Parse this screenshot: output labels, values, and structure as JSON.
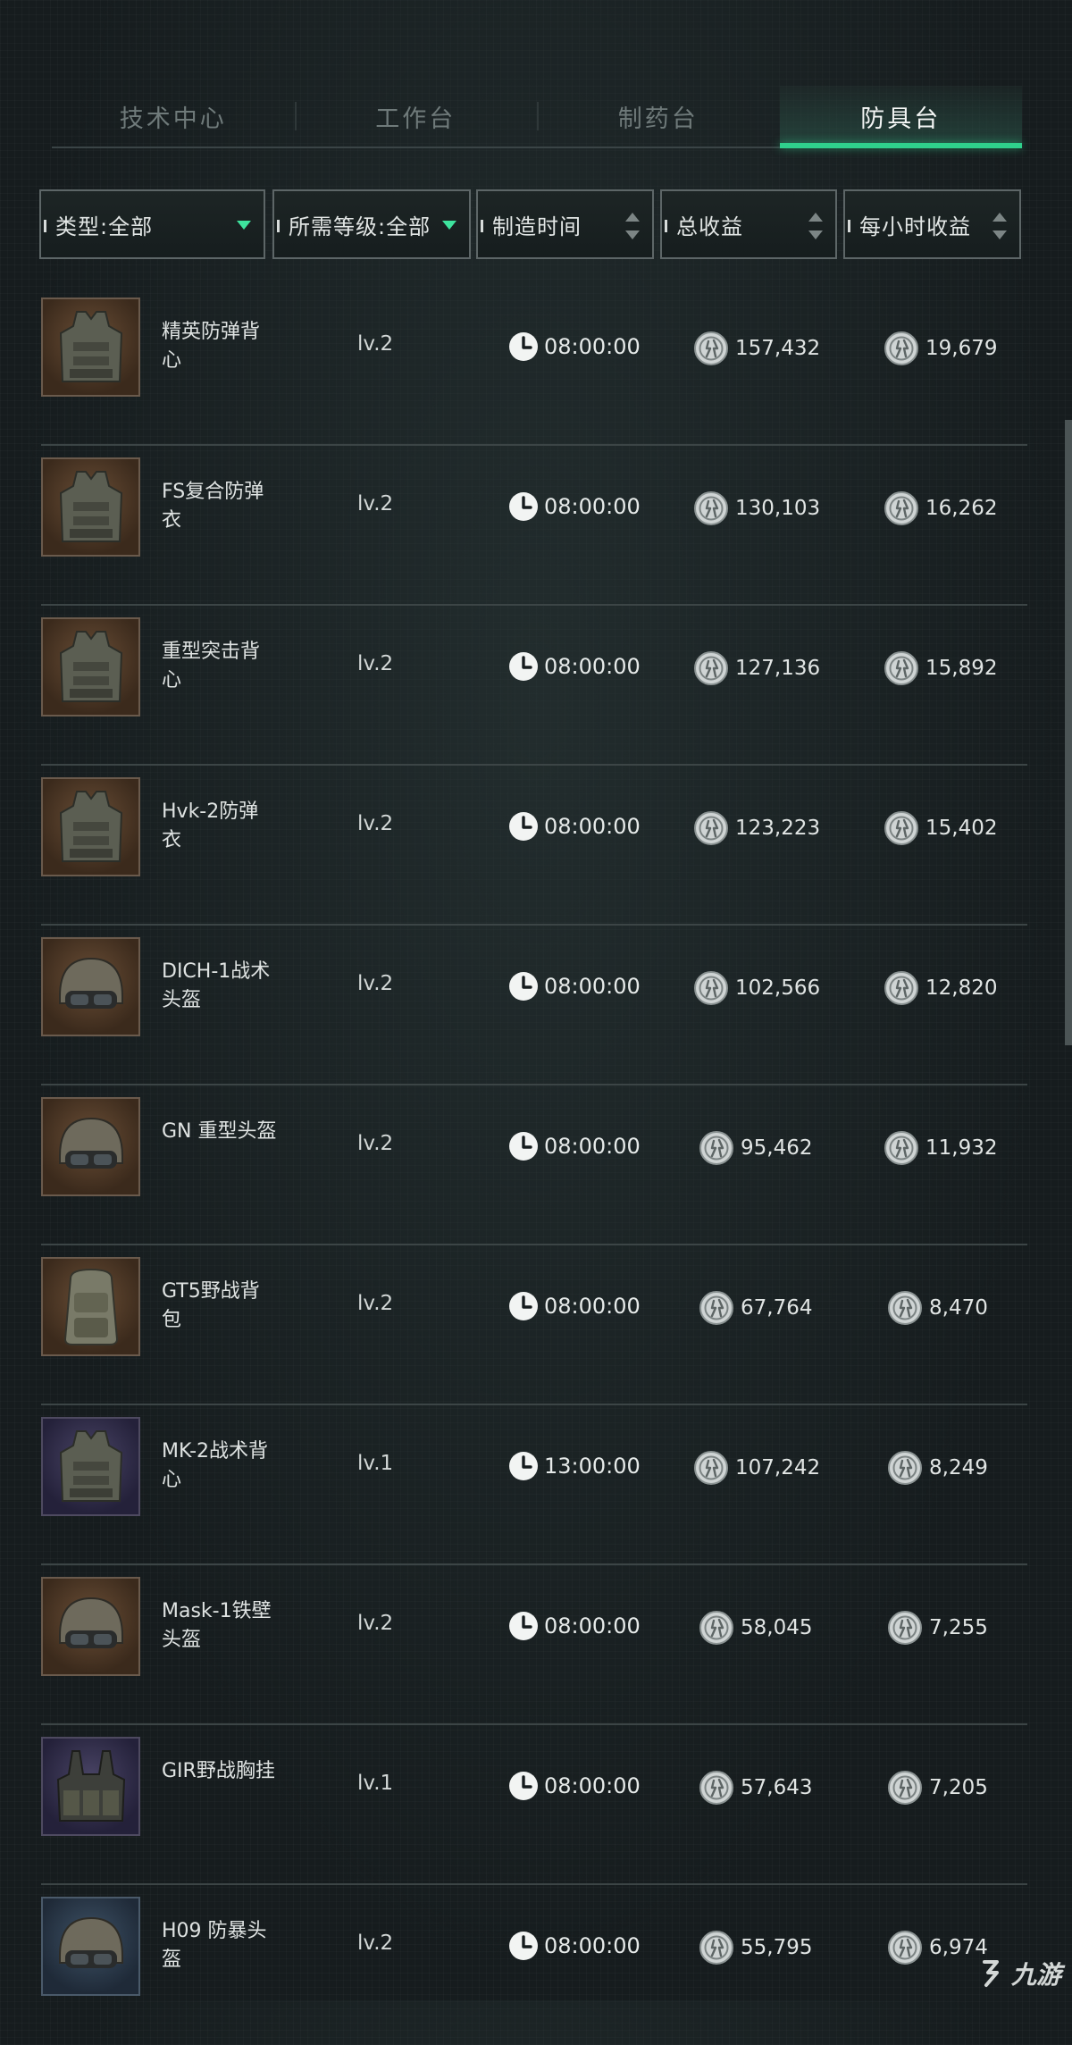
{
  "tabs": [
    {
      "label": "技术中心",
      "active": false
    },
    {
      "label": "工作台",
      "active": false
    },
    {
      "label": "制药台",
      "active": false
    },
    {
      "label": "防具台",
      "active": true
    }
  ],
  "filters": {
    "type": "类型:全部",
    "level": "所需等级:全部",
    "time": "制造时间",
    "total": "总收益",
    "hourly": "每小时收益"
  },
  "colors": {
    "accent": "#2fd08c",
    "background": "#161c1e",
    "divider": "#3c4546"
  },
  "items": [
    {
      "name": "精英防弹背心",
      "level": "lv.2",
      "time": "08:00:00",
      "total": "157,432",
      "hourly": "19,679",
      "icon": "vest-icon",
      "rarity": "orange"
    },
    {
      "name": "FS复合防弹衣",
      "level": "lv.2",
      "time": "08:00:00",
      "total": "130,103",
      "hourly": "16,262",
      "icon": "vest-icon",
      "rarity": "orange"
    },
    {
      "name": "重型突击背心",
      "level": "lv.2",
      "time": "08:00:00",
      "total": "127,136",
      "hourly": "15,892",
      "icon": "vest-icon",
      "rarity": "orange"
    },
    {
      "name": "Hvk-2防弹衣",
      "level": "lv.2",
      "time": "08:00:00",
      "total": "123,223",
      "hourly": "15,402",
      "icon": "vest-icon",
      "rarity": "orange"
    },
    {
      "name": "DICH-1战术头盔",
      "level": "lv.2",
      "time": "08:00:00",
      "total": "102,566",
      "hourly": "12,820",
      "icon": "helmet-icon",
      "rarity": "orange"
    },
    {
      "name": "GN 重型头盔",
      "level": "lv.2",
      "time": "08:00:00",
      "total": "95,462",
      "hourly": "11,932",
      "icon": "helmet-icon",
      "rarity": "orange"
    },
    {
      "name": "GT5野战背包",
      "level": "lv.2",
      "time": "08:00:00",
      "total": "67,764",
      "hourly": "8,470",
      "icon": "backpack-icon",
      "rarity": "orange"
    },
    {
      "name": "MK-2战术背心",
      "level": "lv.1",
      "time": "13:00:00",
      "total": "107,242",
      "hourly": "8,249",
      "icon": "vest-icon",
      "rarity": "purple"
    },
    {
      "name": "Mask-1铁壁头盔",
      "level": "lv.2",
      "time": "08:00:00",
      "total": "58,045",
      "hourly": "7,255",
      "icon": "helmet-icon",
      "rarity": "orange"
    },
    {
      "name": "GIR野战胸挂",
      "level": "lv.1",
      "time": "08:00:00",
      "total": "57,643",
      "hourly": "7,205",
      "icon": "chest-rig-icon",
      "rarity": "purple"
    },
    {
      "name": "H09 防暴头盔",
      "level": "lv.2",
      "time": "08:00:00",
      "total": "55,795",
      "hourly": "6,974",
      "icon": "helmet-icon",
      "rarity": "blue"
    }
  ],
  "watermark": "九游"
}
